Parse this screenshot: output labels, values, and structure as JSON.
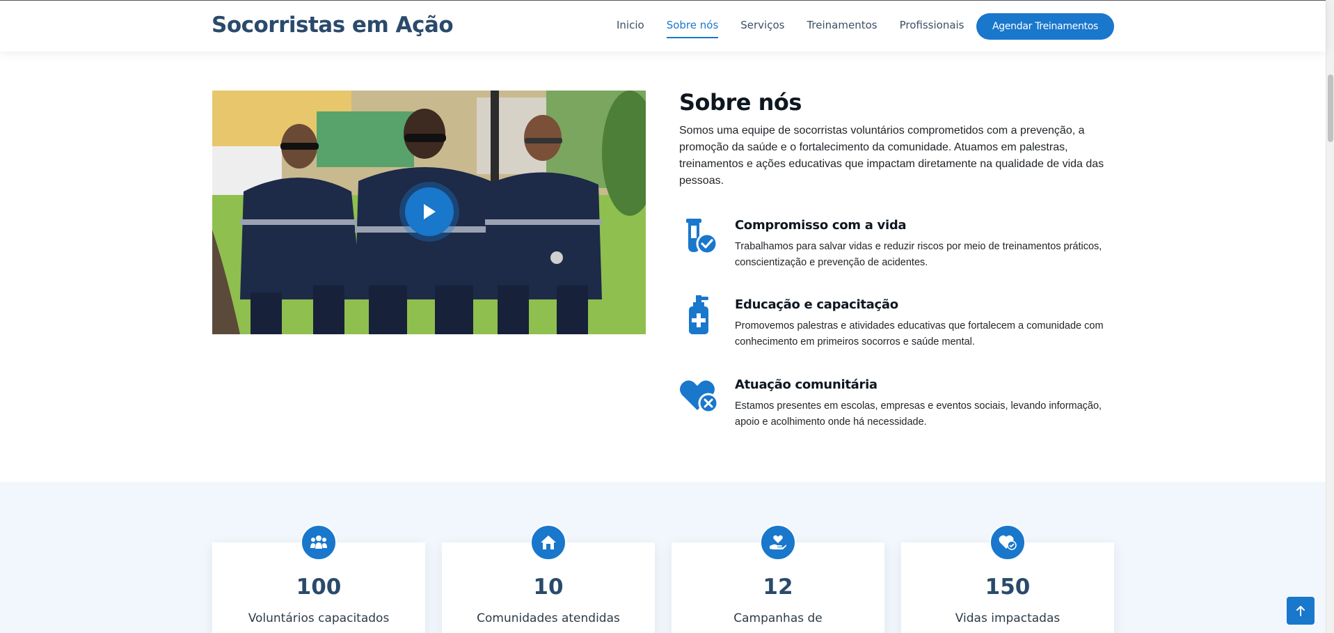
{
  "header": {
    "logo": "Socorristas em Ação",
    "nav": [
      "Inicio",
      "Sobre nós",
      "Serviços",
      "Treinamentos",
      "Profissionais"
    ],
    "active_nav": "Sobre nós",
    "cta": "Agendar Treinamentos"
  },
  "about": {
    "title": "Sobre nós",
    "text": "Somos uma equipe de socorristas voluntários comprometidos com a prevenção, a promoção da saúde e o fortalecimento da comunidade. Atuamos em palestras, treinamentos e ações educativas que impactam diretamente na qualidade de vida das pessoas.",
    "video_icon": "play-icon",
    "features": [
      {
        "icon": "vial-check-icon",
        "title": "Compromisso com a vida",
        "text": "Trabalhamos para salvar vidas e reduzir riscos por meio de treinamentos práticos, conscientização e prevenção de acidentes."
      },
      {
        "icon": "pump-medical-icon",
        "title": "Educação e capacitação",
        "text": "Promovemos palestras e atividades educativas que fortalecem a comunidade com conhecimento em primeiros socorros e saúde mental."
      },
      {
        "icon": "heart-x-icon",
        "title": "Atuação comunitária",
        "text": "Estamos presentes em escolas, empresas e eventos sociais, levando informação, apoio e acolhimento onde há necessidade."
      }
    ]
  },
  "stats": [
    {
      "icon": "people-icon",
      "value": "100",
      "label": "Voluntários capacitados"
    },
    {
      "icon": "house-icon",
      "value": "10",
      "label": "Comunidades atendidas"
    },
    {
      "icon": "hand-heart-icon",
      "value": "12",
      "label": "Campanhas de"
    },
    {
      "icon": "heart-check-icon",
      "value": "150",
      "label": "Vidas impactadas"
    }
  ],
  "colors": {
    "primary": "#1977cc",
    "heading": "#2a4a6b",
    "stats_background": "#f1f7fd"
  }
}
